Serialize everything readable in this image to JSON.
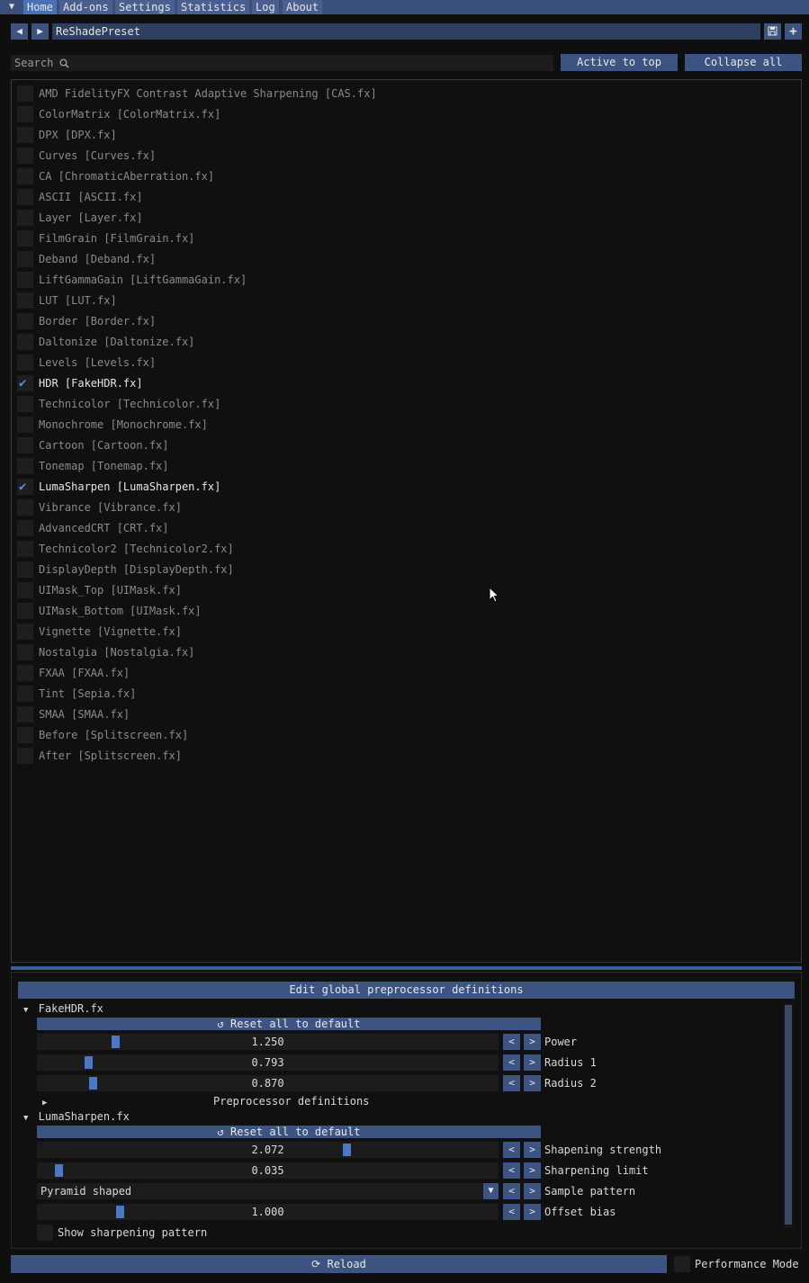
{
  "menubar": {
    "tabs": [
      {
        "label": "Home",
        "active": true
      },
      {
        "label": "Add-ons"
      },
      {
        "label": "Settings"
      },
      {
        "label": "Statistics"
      },
      {
        "label": "Log"
      },
      {
        "label": "About"
      }
    ]
  },
  "preset": {
    "name": "ReShadePreset"
  },
  "search": {
    "placeholder": "Search"
  },
  "toolbar": {
    "active_to_top": "Active to top",
    "collapse_all": "Collapse all"
  },
  "effects": [
    {
      "label": "AMD FidelityFX Contrast Adaptive Sharpening [CAS.fx]",
      "checked": false
    },
    {
      "label": "ColorMatrix [ColorMatrix.fx]",
      "checked": false
    },
    {
      "label": "DPX [DPX.fx]",
      "checked": false
    },
    {
      "label": "Curves [Curves.fx]",
      "checked": false
    },
    {
      "label": "CA [ChromaticAberration.fx]",
      "checked": false
    },
    {
      "label": "ASCII [ASCII.fx]",
      "checked": false
    },
    {
      "label": "Layer [Layer.fx]",
      "checked": false
    },
    {
      "label": "FilmGrain [FilmGrain.fx]",
      "checked": false
    },
    {
      "label": "Deband [Deband.fx]",
      "checked": false
    },
    {
      "label": "LiftGammaGain [LiftGammaGain.fx]",
      "checked": false
    },
    {
      "label": "LUT [LUT.fx]",
      "checked": false
    },
    {
      "label": "Border [Border.fx]",
      "checked": false
    },
    {
      "label": "Daltonize [Daltonize.fx]",
      "checked": false
    },
    {
      "label": "Levels [Levels.fx]",
      "checked": false
    },
    {
      "label": "HDR [FakeHDR.fx]",
      "checked": true
    },
    {
      "label": "Technicolor [Technicolor.fx]",
      "checked": false
    },
    {
      "label": "Monochrome [Monochrome.fx]",
      "checked": false
    },
    {
      "label": "Cartoon [Cartoon.fx]",
      "checked": false
    },
    {
      "label": "Tonemap [Tonemap.fx]",
      "checked": false
    },
    {
      "label": "LumaSharpen [LumaSharpen.fx]",
      "checked": true
    },
    {
      "label": "Vibrance [Vibrance.fx]",
      "checked": false
    },
    {
      "label": "AdvancedCRT [CRT.fx]",
      "checked": false
    },
    {
      "label": "Technicolor2 [Technicolor2.fx]",
      "checked": false
    },
    {
      "label": "DisplayDepth [DisplayDepth.fx]",
      "checked": false
    },
    {
      "label": "UIMask_Top [UIMask.fx]",
      "checked": false
    },
    {
      "label": "UIMask_Bottom [UIMask.fx]",
      "checked": false
    },
    {
      "label": "Vignette [Vignette.fx]",
      "checked": false
    },
    {
      "label": "Nostalgia [Nostalgia.fx]",
      "checked": false
    },
    {
      "label": "FXAA [FXAA.fx]",
      "checked": false
    },
    {
      "label": "Tint [Sepia.fx]",
      "checked": false
    },
    {
      "label": "SMAA [SMAA.fx]",
      "checked": false
    },
    {
      "label": "Before [Splitscreen.fx]",
      "checked": false
    },
    {
      "label": "After [Splitscreen.fx]",
      "checked": false
    }
  ],
  "settings": {
    "edit_global": "Edit global preprocessor definitions",
    "fakehdr": {
      "title": "FakeHDR.fx",
      "reset": "Reset all to default",
      "params": [
        {
          "label": "Power",
          "value": "1.250",
          "fraction": 0.165
        },
        {
          "label": "Radius 1",
          "value": "0.793",
          "fraction": 0.105
        },
        {
          "label": "Radius 2",
          "value": "0.870",
          "fraction": 0.115
        }
      ],
      "preprocessor": "Preprocessor definitions"
    },
    "lumasharpen": {
      "title": "LumaSharpen.fx",
      "reset": "Reset all to default",
      "params": [
        {
          "label": "Shapening strength",
          "value": "2.072",
          "fraction": 0.675
        },
        {
          "label": "Sharpening limit",
          "value": "0.035",
          "fraction": 0.04
        }
      ],
      "sample_pattern": {
        "label": "Sample pattern",
        "value": "Pyramid shaped"
      },
      "offset_bias": {
        "label": "Offset bias",
        "value": "1.000",
        "fraction": 0.175
      },
      "show_pattern": "Show sharpening pattern"
    }
  },
  "footer": {
    "reload": "Reload",
    "performance_mode": "Performance Mode"
  },
  "step_labels": {
    "dec": "<",
    "inc": ">"
  }
}
